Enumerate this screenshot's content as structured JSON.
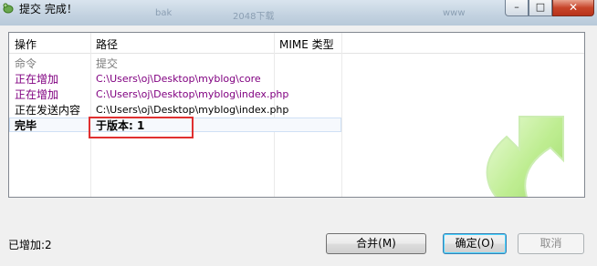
{
  "window": {
    "title": "提交 完成！",
    "background_words": [
      "",
      "bak",
      "2048下载",
      "",
      "www",
      ""
    ],
    "buttons": {
      "minimize": "–",
      "maximize": "□",
      "close": "✕"
    }
  },
  "table": {
    "columns": [
      "操作",
      "路径",
      "MIME 类型"
    ],
    "rows": [
      {
        "action": "命令",
        "path": "提交",
        "style": "gray"
      },
      {
        "action": "正在增加",
        "path": "C:\\Users\\oj\\Desktop\\myblog\\core",
        "style": "purple"
      },
      {
        "action": "正在增加",
        "path": "C:\\Users\\oj\\Desktop\\myblog\\index.php",
        "style": "purple"
      },
      {
        "action": "正在发送内容",
        "path": "C:\\Users\\oj\\Desktop\\myblog\\index.php",
        "style": "normal"
      },
      {
        "action": "完毕",
        "path": "于版本: 1",
        "style": "bold"
      }
    ]
  },
  "footer": {
    "status": "已增加:2",
    "merge_label": "合并(M)",
    "ok_label": "确定(O)",
    "cancel_label": "取消"
  },
  "colors": {
    "added": "#800080",
    "command": "#7d7d7d",
    "highlight": "#e03030",
    "arrow": "#9adf5a"
  }
}
